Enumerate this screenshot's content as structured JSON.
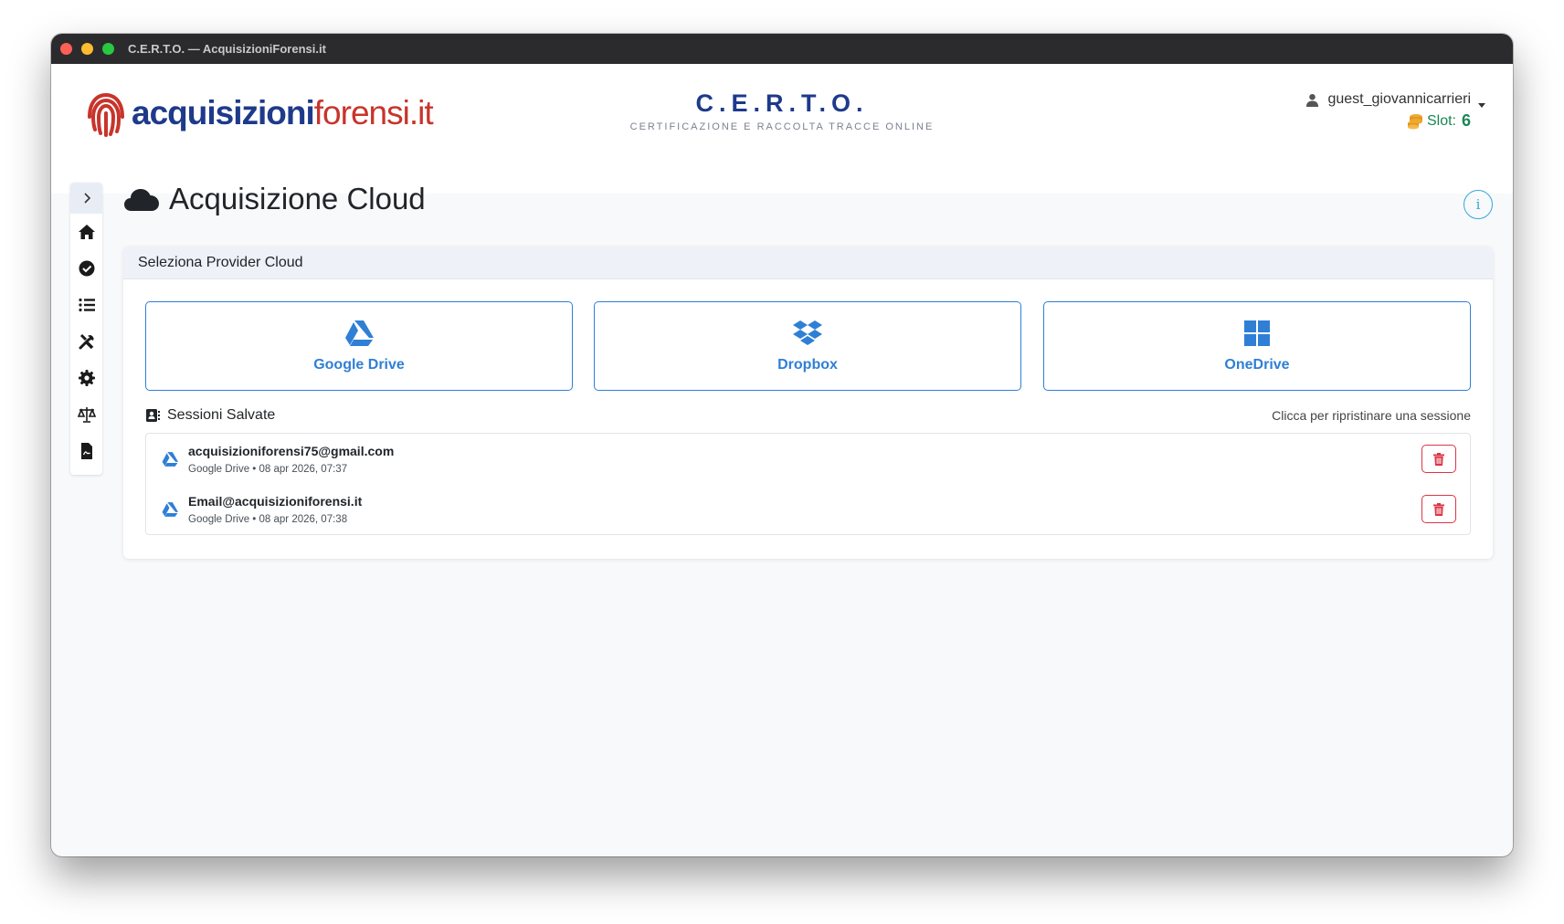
{
  "window": {
    "title": "C.E.R.T.O. — AcquisizioniForensi.it"
  },
  "header": {
    "logo_part1": "acquisizioni",
    "logo_part2": "forensi.it",
    "brand_title": "C.E.R.T.O.",
    "brand_subtitle": "CERTIFICAZIONE E RACCOLTA TRACCE ONLINE",
    "username": "guest_giovannicarrieri",
    "slot_label": "Slot:",
    "slot_value": "6"
  },
  "sidebar": {
    "items": [
      "home-icon",
      "check-circle-icon",
      "list-icon",
      "tools-icon",
      "gear-icon",
      "scale-icon",
      "file-signature-icon"
    ]
  },
  "page": {
    "title": "Acquisizione Cloud",
    "info_label": "i"
  },
  "card": {
    "header": "Seleziona Provider Cloud",
    "providers": [
      {
        "label": "Google Drive",
        "icon": "google-drive-icon"
      },
      {
        "label": "Dropbox",
        "icon": "dropbox-icon"
      },
      {
        "label": "OneDrive",
        "icon": "onedrive-icon"
      }
    ],
    "saved_title": "Sessioni Salvate",
    "saved_hint": "Clicca per ripristinare una sessione",
    "sessions": [
      {
        "email": "acquisizioniforensi75@gmail.com",
        "meta": "Google Drive • 08 apr 2026, 07:37"
      },
      {
        "email": "Email@acquisizioniforensi.it",
        "meta": "Google Drive • 08 apr 2026, 07:38"
      }
    ]
  },
  "colors": {
    "brand_navy": "#1e3a8a",
    "brand_red": "#c8342b",
    "primary_blue": "#2f7fd6",
    "danger": "#dc3545",
    "slot_green": "#198754",
    "info": "#35a6d9"
  }
}
